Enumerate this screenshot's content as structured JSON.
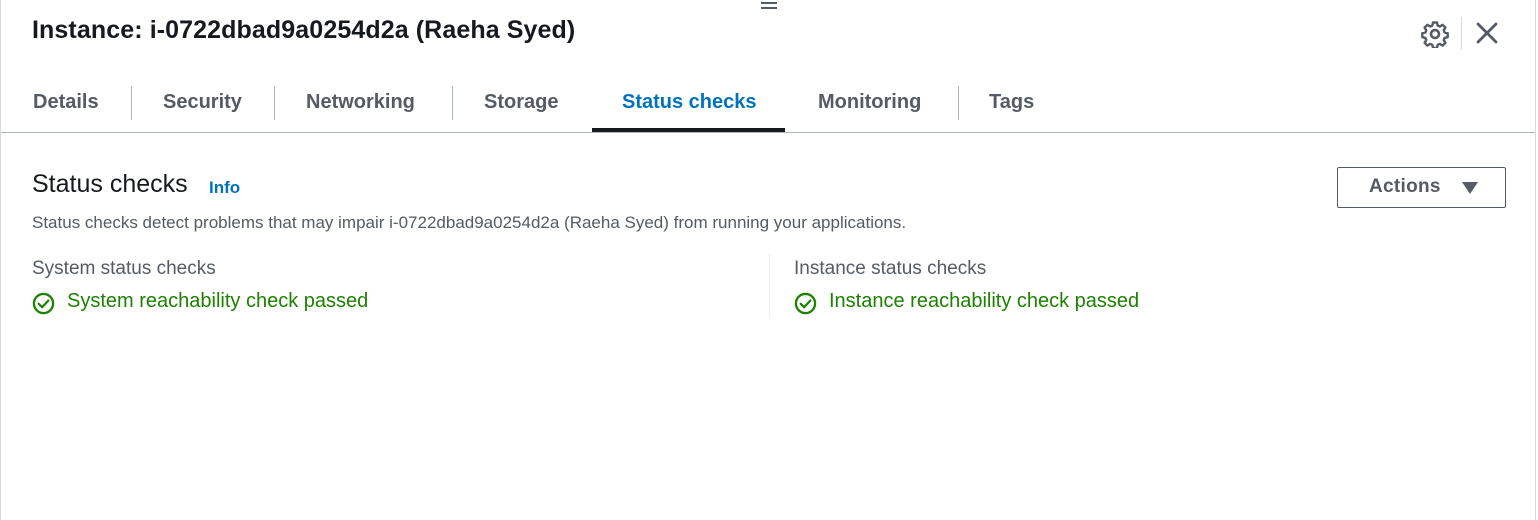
{
  "header": {
    "title": "Instance: i-0722dbad9a0254d2a (Raeha Syed)"
  },
  "tabs": [
    {
      "label": "Details",
      "active": false
    },
    {
      "label": "Security",
      "active": false
    },
    {
      "label": "Networking",
      "active": false
    },
    {
      "label": "Storage",
      "active": false
    },
    {
      "label": "Status checks",
      "active": true
    },
    {
      "label": "Monitoring",
      "active": false
    },
    {
      "label": "Tags",
      "active": false
    }
  ],
  "section": {
    "title": "Status checks",
    "info_label": "Info",
    "actions_label": "Actions",
    "description": "Status checks detect problems that may impair i-0722dbad9a0254d2a (Raeha Syed) from running your applications."
  },
  "system_checks": {
    "label": "System status checks",
    "status": "System reachability check passed"
  },
  "instance_checks": {
    "label": "Instance status checks",
    "status": "Instance reachability check passed"
  },
  "icons": {
    "settings": "gear-icon",
    "close": "close-icon",
    "dropdown": "caret-down-icon",
    "status": "check-circle-icon",
    "handle": "drag-handle-icon"
  },
  "colors": {
    "active_tab": "#0073bb",
    "link": "#0073bb",
    "success": "#1d8102",
    "text_secondary": "#545b64"
  }
}
